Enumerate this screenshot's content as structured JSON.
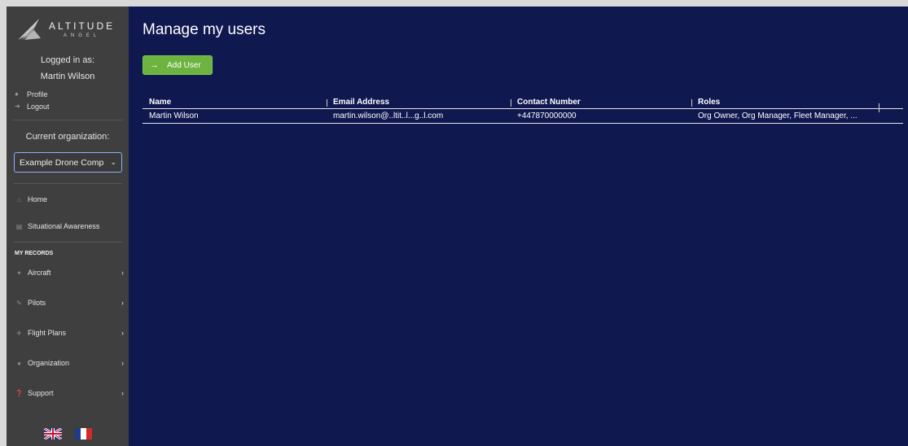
{
  "brand": {
    "name": "ALTITUDE",
    "sub": "ANGEL"
  },
  "session": {
    "logged_in_label": "Logged in as:",
    "user_name": "Martin Wilson"
  },
  "account_links": [
    {
      "label": "Profile",
      "icon": "user-icon"
    },
    {
      "label": "Logout",
      "icon": "logout-icon"
    }
  ],
  "organization": {
    "label": "Current organization:",
    "selected": "Example Drone Comp"
  },
  "nav": {
    "home": "Home",
    "situational_awareness": "Situational Awareness",
    "section_title": "MY RECORDS",
    "records": [
      {
        "label": "Aircraft",
        "icon": "aircraft-icon"
      },
      {
        "label": "Pilots",
        "icon": "pilot-icon"
      },
      {
        "label": "Flight Plans",
        "icon": "flight-plans-icon"
      },
      {
        "label": "Organization",
        "icon": "organization-icon"
      },
      {
        "label": "Support",
        "icon": "support-icon"
      }
    ]
  },
  "languages": [
    "English (UK flag)",
    "French (FR flag)"
  ],
  "main": {
    "title": "Manage my users",
    "add_button": "Add User",
    "table": {
      "headers": [
        "Name",
        "Email Address",
        "Contact Number",
        "Roles"
      ],
      "rows": [
        [
          "Martin Wilson",
          "martin.wilson@..ltit..l...g..l.com",
          "+447870000000",
          "Org Owner, Org Manager, Fleet Manager, ..."
        ]
      ]
    }
  },
  "colors": {
    "sidebar": "#3f3f3f",
    "main_bg": "#101850",
    "accent_green": "#6cb33f"
  }
}
